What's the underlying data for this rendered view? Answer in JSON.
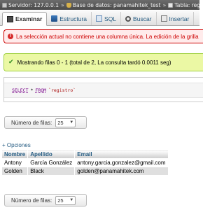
{
  "breadcrumb": {
    "server": "Servidor: 127.0.0.1",
    "database": "Base de datos: panamahitek_test",
    "table": "Tabla: registro"
  },
  "tabs": [
    {
      "label": "Examinar",
      "icon": "browse-icon",
      "active": true
    },
    {
      "label": "Estructura",
      "icon": "structure-icon",
      "active": false
    },
    {
      "label": "SQL",
      "icon": "sql-icon",
      "active": false
    },
    {
      "label": "Buscar",
      "icon": "search-icon",
      "active": false
    },
    {
      "label": "Insertar",
      "icon": "insert-icon",
      "active": false
    }
  ],
  "warning": {
    "text": "La selección actual no contiene una columna única. La edición de la grilla"
  },
  "success": {
    "text": "Mostrando filas 0 - 1 (total de 2, La consulta tardó 0.0011 seg)"
  },
  "sql": {
    "select": "SELECT",
    "star": "*",
    "from": "FROM",
    "table": "`registro`"
  },
  "row_selector": {
    "label": "Número de filas:",
    "value": "25"
  },
  "options_link": "+ Opciones",
  "table": {
    "headers": [
      "Nombre",
      "Apellido",
      "Email"
    ],
    "rows": [
      [
        "Antony",
        "García González",
        "antony.garcia.gonzalez@gmail.com"
      ],
      [
        "Golden",
        "Black",
        "golden@panamahitek.com"
      ]
    ]
  },
  "row_selector_bottom": {
    "label": "Número de filas:",
    "value": "25"
  },
  "colors": {
    "link": "#235a81",
    "error": "#cc0000",
    "success_bg": "#ebf8a4",
    "error_bg": "#ffebeb"
  }
}
